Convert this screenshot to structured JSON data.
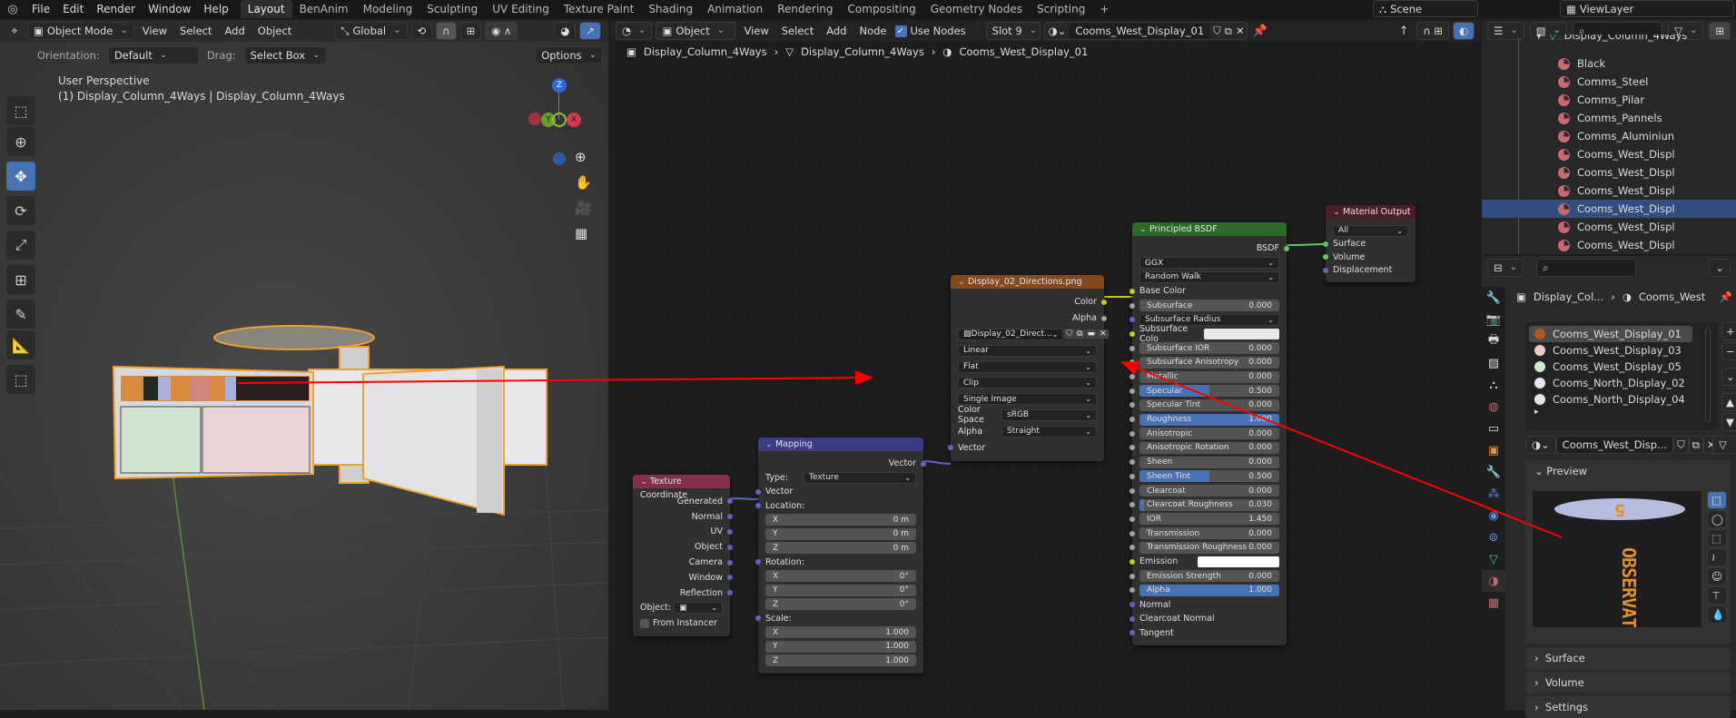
{
  "topbar": {
    "menus": [
      "File",
      "Edit",
      "Render",
      "Window",
      "Help"
    ],
    "workspaces": [
      "Layout",
      "BenAnim",
      "Modeling",
      "Sculpting",
      "UV Editing",
      "Texture Paint",
      "Shading",
      "Animation",
      "Rendering",
      "Compositing",
      "Geometry Nodes",
      "Scripting"
    ],
    "active_workspace": "Layout",
    "add_tab": "+",
    "scene": "Scene",
    "view_layer": "ViewLayer"
  },
  "viewport": {
    "mode": "Object Mode",
    "menus": [
      "View",
      "Select",
      "Add",
      "Object"
    ],
    "transform_orientation": "Global",
    "orientation_label": "Orientation:",
    "orientation_value": "Default",
    "drag_label": "Drag:",
    "drag_value": "Select Box",
    "options": "Options",
    "perspective": "User Perspective",
    "object_info": "(1) Display_Column_4Ways | Display_Column_4Ways",
    "gizmo": {
      "z": "Z",
      "y": "Y",
      "x": "X"
    },
    "tools": [
      "select-box",
      "cursor",
      "move",
      "rotate",
      "scale",
      "transform",
      "annotate",
      "measure",
      "add-cube"
    ],
    "active_tool": "move"
  },
  "node_editor": {
    "type": "Object",
    "menus": [
      "View",
      "Select",
      "Add",
      "Node"
    ],
    "use_nodes_label": "Use Nodes",
    "use_nodes": true,
    "slot": "Slot 9",
    "material": "Cooms_West_Display_01",
    "breadcrumb": [
      "Display_Column_4Ways",
      "Display_Column_4Ways",
      "Cooms_West_Display_01"
    ],
    "nodes": {
      "texcoord": {
        "title": "Texture Coordinate",
        "color": "#83314a",
        "rows": [
          {
            "t": "out",
            "l": "Generated",
            "s": "#6363c7"
          },
          {
            "t": "out",
            "l": "Normal",
            "s": "#6363c7"
          },
          {
            "t": "out",
            "l": "UV",
            "s": "#6363c7"
          },
          {
            "t": "out",
            "l": "Object",
            "s": "#6363c7"
          },
          {
            "t": "out",
            "l": "Camera",
            "s": "#6363c7"
          },
          {
            "t": "out",
            "l": "Window",
            "s": "#6363c7"
          },
          {
            "t": "out",
            "l": "Reflection",
            "s": "#6363c7"
          },
          {
            "t": "objfield",
            "l": "Object:"
          },
          {
            "t": "check",
            "l": "From Instancer"
          }
        ]
      },
      "mapping": {
        "title": "Mapping",
        "color": "#3c3c83",
        "rows": [
          {
            "t": "out",
            "l": "Vector",
            "s": "#6363c7"
          },
          {
            "t": "labdrop",
            "l": "Type:",
            "v": "Texture"
          },
          {
            "t": "in",
            "l": "Vector",
            "s": "#6363c7"
          },
          {
            "t": "in",
            "l": "Location:",
            "s": "#6363c7"
          },
          {
            "t": "fld",
            "l": "X",
            "v": "0 m"
          },
          {
            "t": "fld",
            "l": "Y",
            "v": "0 m"
          },
          {
            "t": "fld",
            "l": "Z",
            "v": "0 m"
          },
          {
            "t": "in",
            "l": "Rotation:",
            "s": "#6363c7"
          },
          {
            "t": "fld",
            "l": "X",
            "v": "0°"
          },
          {
            "t": "fld",
            "l": "Y",
            "v": "0°"
          },
          {
            "t": "fld",
            "l": "Z",
            "v": "0°"
          },
          {
            "t": "in",
            "l": "Scale:",
            "s": "#6363c7"
          },
          {
            "t": "fld",
            "l": "X",
            "v": "1.000"
          },
          {
            "t": "fld",
            "l": "Y",
            "v": "1.000"
          },
          {
            "t": "fld",
            "l": "Z",
            "v": "1.000"
          }
        ]
      },
      "image": {
        "title": "Display_02_Directions.png",
        "color": "#83491c",
        "rows": [
          {
            "t": "out",
            "l": "Color",
            "s": "#c7c729"
          },
          {
            "t": "out",
            "l": "Alpha",
            "s": "#a1a1a1"
          },
          {
            "t": "imgsel",
            "v": "Display_02_Direct..."
          },
          {
            "t": "drop",
            "v": "Linear"
          },
          {
            "t": "drop",
            "v": "Flat"
          },
          {
            "t": "drop",
            "v": "Clip"
          },
          {
            "t": "drop",
            "v": "Single Image"
          },
          {
            "t": "labdrop",
            "l": "Color Space",
            "v": "sRGB"
          },
          {
            "t": "labdrop",
            "l": "Alpha",
            "v": "Straight"
          },
          {
            "t": "in",
            "l": "Vector",
            "s": "#6363c7"
          }
        ]
      },
      "bsdf": {
        "title": "Principled BSDF",
        "color": "#2c6a2c",
        "rows": [
          {
            "t": "out",
            "l": "BSDF",
            "s": "#63c763"
          },
          {
            "t": "drop",
            "v": "GGX"
          },
          {
            "t": "drop",
            "v": "Random Walk"
          },
          {
            "t": "in",
            "l": "Base Color",
            "s": "#c7c729"
          },
          {
            "t": "fld",
            "l": "Subsurface",
            "v": "0.000",
            "f": 0,
            "s": "#a1a1a1"
          },
          {
            "t": "drop",
            "v": "Subsurface Radius",
            "s": "#6363c7"
          },
          {
            "t": "color",
            "l": "Subsurface Colo",
            "c": "#e8e8e8",
            "s": "#c7c729"
          },
          {
            "t": "fld",
            "l": "Subsurface IOR",
            "v": "0.000",
            "f": 0,
            "s": "#a1a1a1"
          },
          {
            "t": "fld",
            "l": "Subsurface Anisotropy",
            "v": "0.000",
            "f": 0,
            "s": "#a1a1a1"
          },
          {
            "t": "fld",
            "l": "Metallic",
            "v": "0.000",
            "f": 0,
            "s": "#a1a1a1"
          },
          {
            "t": "fld",
            "l": "Specular",
            "v": "0.500",
            "f": 0.5,
            "s": "#a1a1a1"
          },
          {
            "t": "fld",
            "l": "Specular Tint",
            "v": "0.000",
            "f": 0,
            "s": "#a1a1a1"
          },
          {
            "t": "fld",
            "l": "Roughness",
            "v": "1.000",
            "f": 1,
            "s": "#a1a1a1"
          },
          {
            "t": "fld",
            "l": "Anisotropic",
            "v": "0.000",
            "f": 0,
            "s": "#a1a1a1"
          },
          {
            "t": "fld",
            "l": "Anisotropic Rotation",
            "v": "0.000",
            "f": 0,
            "s": "#a1a1a1"
          },
          {
            "t": "fld",
            "l": "Sheen",
            "v": "0.000",
            "f": 0,
            "s": "#a1a1a1"
          },
          {
            "t": "fld",
            "l": "Sheen Tint",
            "v": "0.500",
            "f": 0.5,
            "s": "#a1a1a1"
          },
          {
            "t": "fld",
            "l": "Clearcoat",
            "v": "0.000",
            "f": 0,
            "s": "#a1a1a1"
          },
          {
            "t": "fld",
            "l": "Clearcoat Roughness",
            "v": "0.030",
            "f": 0.03,
            "s": "#a1a1a1"
          },
          {
            "t": "fld",
            "l": "IOR",
            "v": "1.450",
            "f": 0,
            "s": "#a1a1a1"
          },
          {
            "t": "fld",
            "l": "Transmission",
            "v": "0.000",
            "f": 0,
            "s": "#a1a1a1"
          },
          {
            "t": "fld",
            "l": "Transmission Roughness",
            "v": "0.000",
            "f": 0,
            "s": "#a1a1a1"
          },
          {
            "t": "color",
            "l": "Emission",
            "c": "#ffffff",
            "s": "#c7c729"
          },
          {
            "t": "fld",
            "l": "Emission Strength",
            "v": "0.000",
            "f": 0,
            "s": "#a1a1a1"
          },
          {
            "t": "fld",
            "l": "Alpha",
            "v": "1.000",
            "f": 1,
            "s": "#a1a1a1"
          },
          {
            "t": "in",
            "l": "Normal",
            "s": "#6363c7"
          },
          {
            "t": "in",
            "l": "Clearcoat Normal",
            "s": "#6363c7"
          },
          {
            "t": "in",
            "l": "Tangent",
            "s": "#6363c7"
          }
        ]
      },
      "output": {
        "title": "Material Output",
        "color": "#4e1e28",
        "rows": [
          {
            "t": "drop",
            "v": "All"
          },
          {
            "t": "in",
            "l": "Surface",
            "s": "#63c763"
          },
          {
            "t": "in",
            "l": "Volume",
            "s": "#63c763"
          },
          {
            "t": "in",
            "l": "Displacement",
            "s": "#6363c7"
          }
        ]
      }
    }
  },
  "outliner": {
    "parent": "Display_Column_4Ways",
    "items": [
      "Black",
      "Comms_Steel",
      "Comms_Pilar",
      "Comms_Pannels",
      "Comms_Aluminiun",
      "Cooms_West_Displ",
      "Cooms_West_Displ",
      "Cooms_West_Displ",
      "Cooms_West_Displ",
      "Cooms_West_Displ",
      "Cooms_West_Displ"
    ],
    "selected_index": 8
  },
  "properties": {
    "breadcrumb_object": "Display_Col...",
    "breadcrumb_material": "Cooms_West",
    "slots": [
      {
        "name": "Cooms_West_Display_01",
        "color": "#b5561e"
      },
      {
        "name": "Cooms_West_Display_03",
        "color": "#f0c8c8"
      },
      {
        "name": "Cooms_West_Display_05",
        "color": "#c8ecc8"
      },
      {
        "name": "Cooms_North_Display_02",
        "color": "#e6e6ee"
      },
      {
        "name": "Cooms_North_Display_04",
        "color": "#e6e6ee"
      }
    ],
    "material_name": "Cooms_West_Disp...",
    "panels": {
      "preview": "Preview",
      "surface": "Surface",
      "volume": "Volume",
      "settings": "Settings"
    },
    "preview_text": "OBSERVATORY",
    "preview_number": "5"
  },
  "colors": {
    "accent": "#4772b3",
    "selection": "#f0a030",
    "annotation": "#ff0000"
  }
}
